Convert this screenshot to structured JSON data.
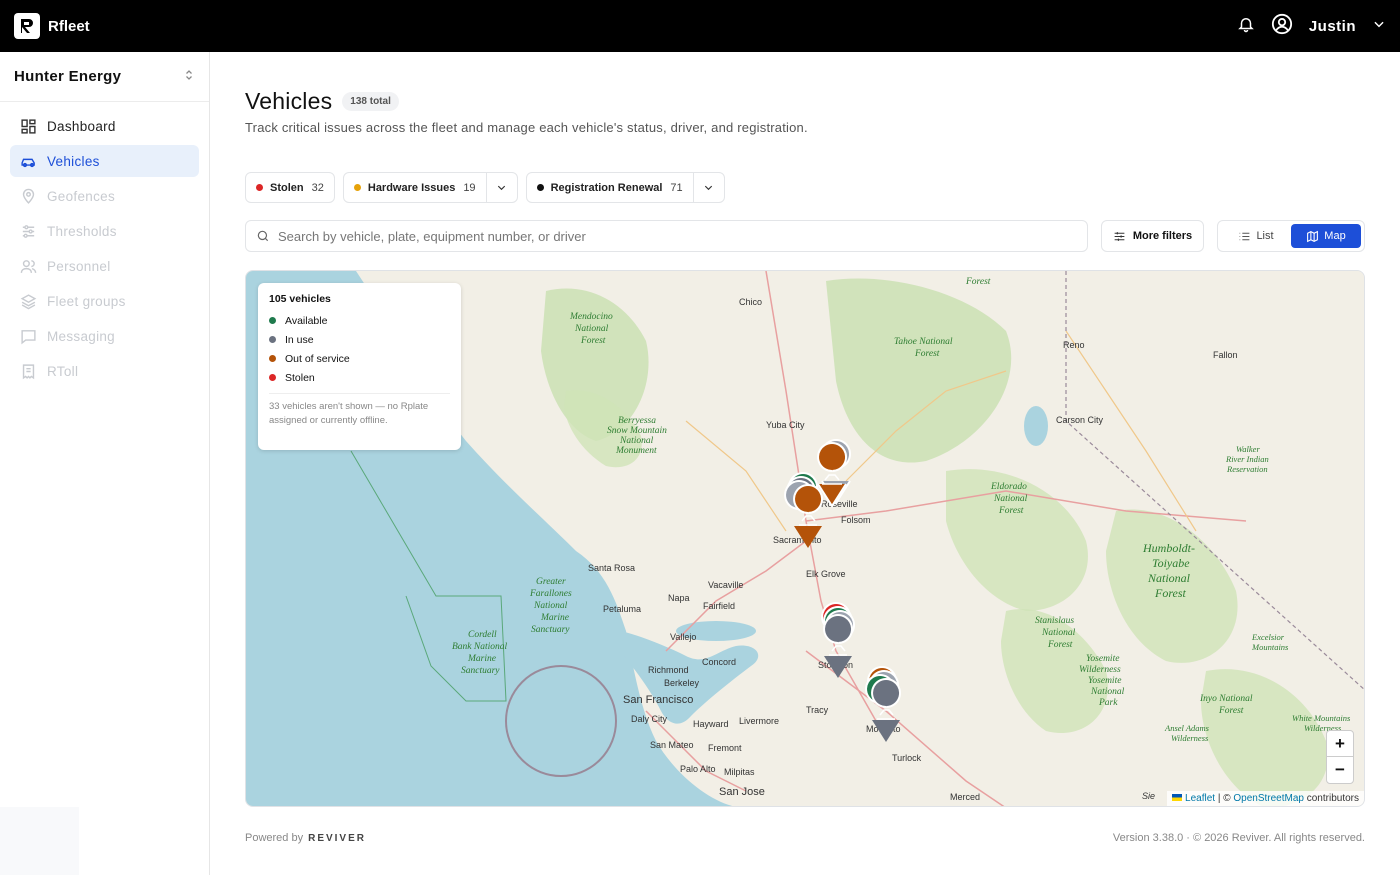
{
  "app": {
    "brand": "Rfleet",
    "user": "Justin"
  },
  "sidebar": {
    "org": "Hunter Energy",
    "items": [
      {
        "label": "Dashboard",
        "icon": "dashboard-icon"
      },
      {
        "label": "Vehicles",
        "icon": "car-icon"
      },
      {
        "label": "Geofences",
        "icon": "pin-icon"
      },
      {
        "label": "Thresholds",
        "icon": "sliders-icon"
      },
      {
        "label": "Personnel",
        "icon": "users-icon"
      },
      {
        "label": "Fleet groups",
        "icon": "layers-icon"
      },
      {
        "label": "Messaging",
        "icon": "message-icon"
      },
      {
        "label": "RToll",
        "icon": "receipt-icon"
      }
    ]
  },
  "page": {
    "title": "Vehicles",
    "total_badge": "138 total",
    "subtitle": "Track critical issues across the fleet and manage each vehicle's status, driver, and registration."
  },
  "chips": [
    {
      "label": "Stolen",
      "count": "32",
      "color": "#dc2626"
    },
    {
      "label": "Hardware Issues",
      "count": "19",
      "color": "#e6a20a"
    },
    {
      "label": "Registration Renewal",
      "count": "71",
      "color": "#111111"
    }
  ],
  "search": {
    "placeholder": "Search by vehicle, plate, equipment number, or driver"
  },
  "toolbar": {
    "more_filters": "More filters",
    "list": "List",
    "map": "Map"
  },
  "legend": {
    "title": "105 vehicles",
    "items": [
      {
        "label": "Available",
        "color": "#1f7a4d"
      },
      {
        "label": "In use",
        "color": "#6b7280"
      },
      {
        "label": "Out of service",
        "color": "#b45309"
      },
      {
        "label": "Stolen",
        "color": "#dc2626"
      }
    ],
    "note": "33 vehicles aren't shown — no Rplate assigned or currently offline."
  },
  "map": {
    "zoom_in": "+",
    "zoom_out": "−",
    "attribution_leaflet": "Leaflet",
    "attribution_sep": " | © ",
    "attribution_osm": "OpenStreetMap",
    "attribution_tail": " contributors",
    "places": [
      "Chico",
      "Reno",
      "Fallon",
      "Yuba City",
      "Carson City",
      "Roseville",
      "Folsom",
      "Sacramento",
      "Elk Grove",
      "Santa Rosa",
      "Vacaville",
      "Napa",
      "Fairfield",
      "Petaluma",
      "Vallejo",
      "Concord",
      "Richmond",
      "Berkeley",
      "San Francisco",
      "Daly City",
      "Hayward",
      "Livermore",
      "San Mateo",
      "Fremont",
      "Palo Alto",
      "Milpitas",
      "San Jose",
      "Tracy",
      "Stockton",
      "Modesto",
      "Turlock",
      "Merced"
    ],
    "areas": [
      "Mendocino National Forest",
      "Tahoe National Forest",
      "Berryessa Snow Mountain National Monument",
      "Eldorado National Forest",
      "Humboldt-Toiyabe National Forest",
      "Walker River Indian Reservation",
      "Greater Farallones National Marine Sanctuary",
      "Cordell Bank National Marine Sanctuary",
      "Stanislaus National Forest",
      "Yosemite Wilderness Yosemite National Park",
      "Excelsior Mountains",
      "Inyo National Forest",
      "Ansel Adams Wilderness",
      "White Mountains Wilderness"
    ]
  },
  "footer": {
    "powered_by": "Powered by",
    "brand": "REVIVER",
    "version": "Version 3.38.0  ·  © 2026 Reviver. All rights reserved."
  }
}
